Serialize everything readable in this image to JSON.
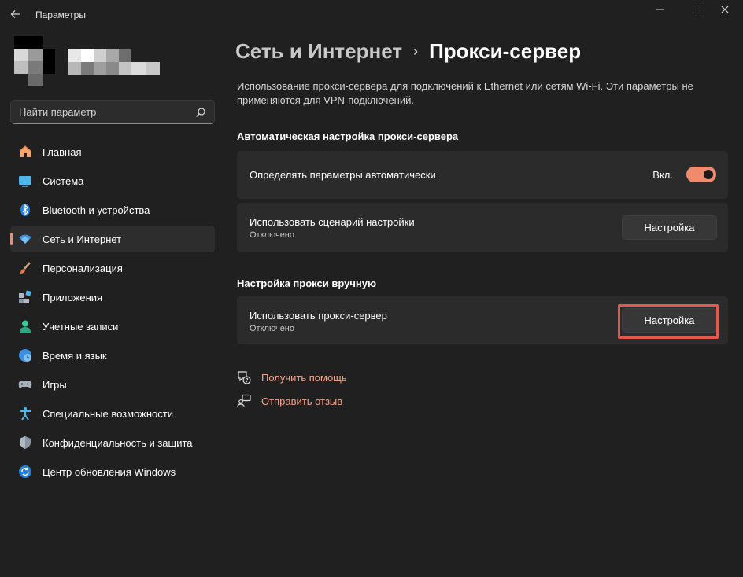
{
  "window": {
    "title": "Параметры"
  },
  "search": {
    "placeholder": "Найти параметр"
  },
  "nav": {
    "items": [
      {
        "label": "Главная",
        "icon": "home-icon"
      },
      {
        "label": "Система",
        "icon": "system-icon"
      },
      {
        "label": "Bluetooth и устройства",
        "icon": "bluetooth-icon"
      },
      {
        "label": "Сеть и Интернет",
        "icon": "wifi-icon",
        "active": true
      },
      {
        "label": "Персонализация",
        "icon": "brush-icon"
      },
      {
        "label": "Приложения",
        "icon": "apps-icon"
      },
      {
        "label": "Учетные записи",
        "icon": "account-icon"
      },
      {
        "label": "Время и язык",
        "icon": "time-language-icon"
      },
      {
        "label": "Игры",
        "icon": "gamepad-icon"
      },
      {
        "label": "Специальные возможности",
        "icon": "accessibility-icon"
      },
      {
        "label": "Конфиденциальность и защита",
        "icon": "shield-icon"
      },
      {
        "label": "Центр обновления Windows",
        "icon": "update-icon"
      }
    ]
  },
  "breadcrumb": {
    "parent": "Сеть и Интернет",
    "separator": "›",
    "current": "Прокси-сервер"
  },
  "description": "Использование прокси-сервера для подключений к Ethernet или сетям Wi-Fi. Эти параметры не применяются для VPN-подключений.",
  "auto_section": {
    "title": "Автоматическая настройка прокси-сервера",
    "detect": {
      "label": "Определять параметры автоматически",
      "toggle_state": "Вкл."
    },
    "script": {
      "label": "Использовать сценарий настройки",
      "status": "Отключено",
      "button": "Настройка"
    }
  },
  "manual_section": {
    "title": "Настройка прокси вручную",
    "proxy": {
      "label": "Использовать прокси-сервер",
      "status": "Отключено",
      "button": "Настройка"
    }
  },
  "links": {
    "help": "Получить помощь",
    "feedback": "Отправить отзыв"
  },
  "colors": {
    "accent": "#f08a6c",
    "highlight_box": "#e35a4d",
    "background": "#202020",
    "card": "#2b2b2b"
  }
}
